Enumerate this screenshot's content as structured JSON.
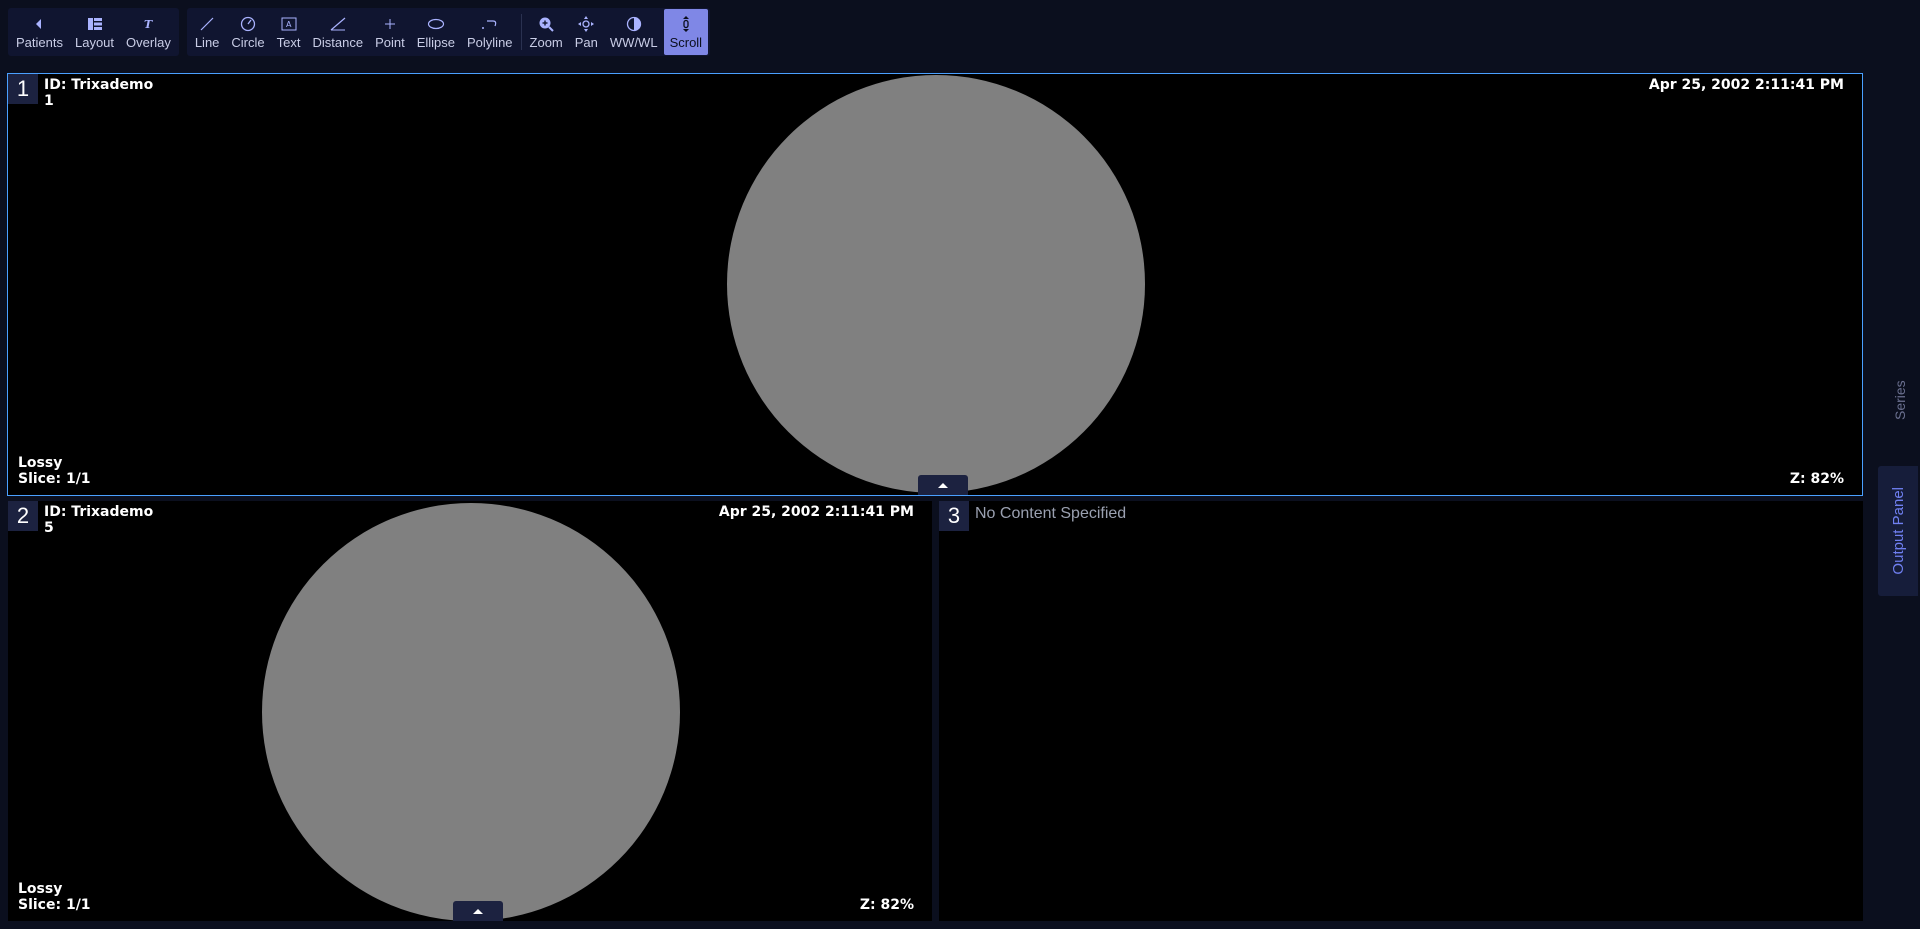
{
  "toolbar": {
    "group1": [
      {
        "id": "patients",
        "label": "Patients",
        "icon": "chevron-left-icon"
      },
      {
        "id": "layout",
        "label": "Layout",
        "icon": "layout-grid-icon"
      },
      {
        "id": "overlay",
        "label": "Overlay",
        "icon": "overlay-text-icon"
      }
    ],
    "group2": [
      {
        "id": "line",
        "label": "Line",
        "icon": "line-icon"
      },
      {
        "id": "circle",
        "label": "Circle",
        "icon": "circle-icon"
      },
      {
        "id": "text",
        "label": "Text",
        "icon": "text-box-icon"
      },
      {
        "id": "distance",
        "label": "Distance",
        "icon": "distance-icon"
      },
      {
        "id": "point",
        "label": "Point",
        "icon": "point-icon"
      },
      {
        "id": "ellipse",
        "label": "Ellipse",
        "icon": "ellipse-icon"
      },
      {
        "id": "polyline",
        "label": "Polyline",
        "icon": "polyline-icon"
      }
    ],
    "group3": [
      {
        "id": "zoom",
        "label": "Zoom",
        "icon": "zoom-icon"
      },
      {
        "id": "pan",
        "label": "Pan",
        "icon": "pan-icon"
      },
      {
        "id": "wwwl",
        "label": "WW/WL",
        "icon": "contrast-icon"
      },
      {
        "id": "scroll",
        "label": "Scroll",
        "icon": "scroll-icon",
        "active": true
      }
    ]
  },
  "viewports": [
    {
      "number": "1",
      "id_line": "ID: Trixademo",
      "sub": "1",
      "datetime": "Apr 25, 2002 2:11:41 PM",
      "compression": "Lossy",
      "slice": "Slice: 1/1",
      "zoom": "Z: 82%"
    },
    {
      "number": "2",
      "id_line": "ID: Trixademo",
      "sub": "5",
      "datetime": "Apr 25, 2002 2:11:41 PM",
      "compression": "Lossy",
      "slice": "Slice: 1/1",
      "zoom": "Z: 82%"
    },
    {
      "number": "3",
      "message": "No Content Specified"
    }
  ],
  "side": {
    "series": "Series",
    "output": "Output Panel"
  },
  "colors": {
    "accent": "#7f87e6",
    "active_border": "#4aa0ff",
    "background": "#0b0f1e",
    "image_gray": "#808080"
  }
}
